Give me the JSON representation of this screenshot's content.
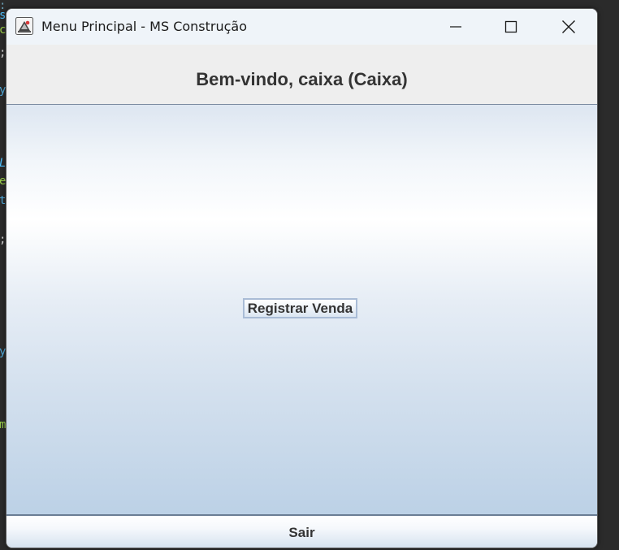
{
  "window": {
    "title": "Menu Principal - MS Construção",
    "icon": "java-cup-icon",
    "controls": {
      "minimize_icon": "minimize-icon",
      "maximize_icon": "maximize-icon",
      "close_icon": "close-icon"
    }
  },
  "header": {
    "welcome_text": "Bem-vindo, caixa (Caixa)"
  },
  "main": {
    "register_sale_label": "Registrar Venda"
  },
  "footer": {
    "exit_label": "Sair"
  },
  "colors": {
    "background_editor": "#2b2b2b",
    "titlebar": "#eff4f9",
    "header_panel": "#eeeeee",
    "text": "#333333",
    "button_border": "#a9bcd6"
  }
}
